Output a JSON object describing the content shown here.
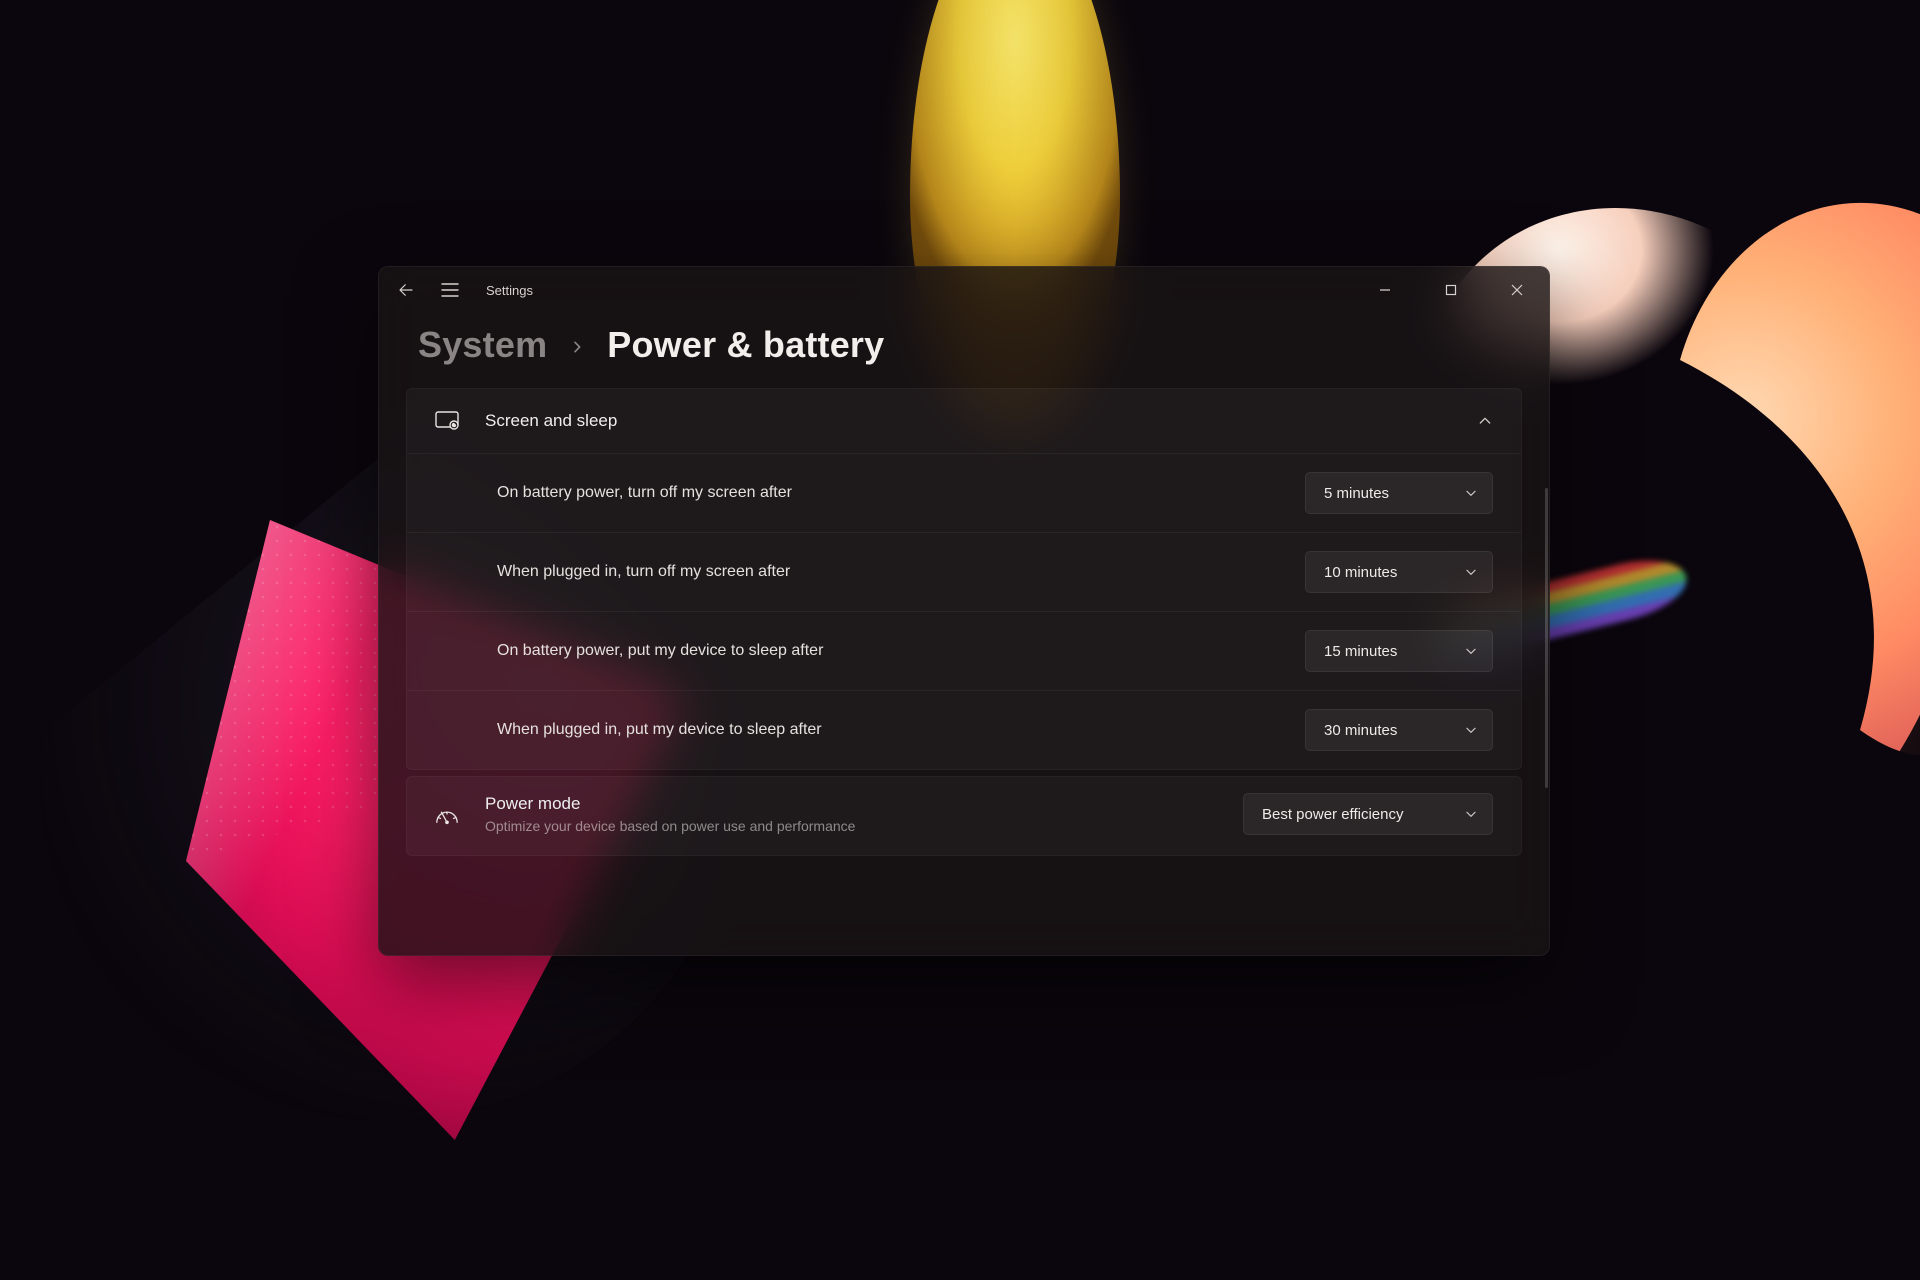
{
  "app_title": "Settings",
  "breadcrumb": {
    "parent": "System",
    "current": "Power & battery"
  },
  "section_screen_sleep": {
    "title": "Screen and sleep",
    "expanded": true
  },
  "rows": [
    {
      "label": "On battery power, turn off my screen after",
      "value": "5 minutes"
    },
    {
      "label": "When plugged in, turn off my screen after",
      "value": "10 minutes"
    },
    {
      "label": "On battery power, put my device to sleep after",
      "value": "15 minutes"
    },
    {
      "label": "When plugged in, put my device to sleep after",
      "value": "30 minutes"
    }
  ],
  "power_mode": {
    "title": "Power mode",
    "subtitle": "Optimize your device based on power use and performance",
    "value": "Best power efficiency"
  }
}
